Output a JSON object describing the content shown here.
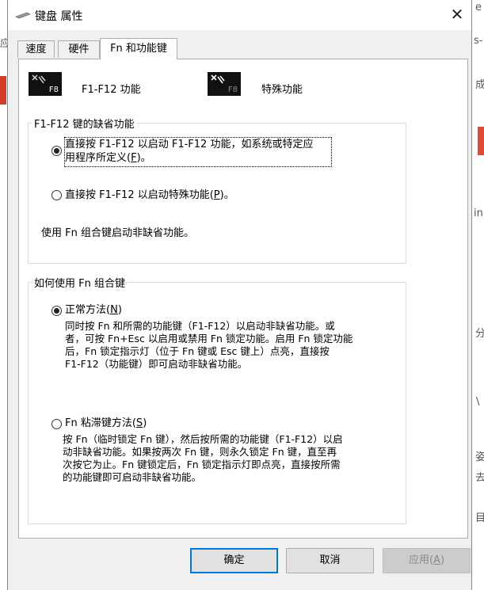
{
  "window": {
    "title": "键盘 属性",
    "close_symbol": "✕"
  },
  "tabs": [
    {
      "label": "速度"
    },
    {
      "label": "硬件"
    },
    {
      "label": "Fn 和功能键"
    }
  ],
  "fkeys": {
    "key_label": "F8",
    "fkey_mode_label": "F1-F12 功能",
    "special_mode_label": "特殊功能"
  },
  "group1": {
    "legend": "F1-F12 键的缺省功能",
    "option1_line1": "直接按 F1-F12 以启动 F1-F12 功能，如系统或特定应",
    "option1_line2_prefix": "用程序所定义(",
    "option1_mnemonic": "F",
    "option1_suffix": ")。",
    "option2_prefix": "直接按 F1-F12 以启动特殊功能(",
    "option2_mnemonic": "P",
    "option2_suffix": ")。",
    "note": "使用 Fn 组合键启动非缺省功能。"
  },
  "group2": {
    "legend": "如何使用 Fn 组合键",
    "normal_prefix": "正常方法(",
    "normal_mnemonic": "N",
    "normal_suffix": ")",
    "normal_desc": [
      "同时按 Fn 和所需的功能键（F1-F12）以启动非缺省功能。或",
      "者，可按 Fn+Esc 以启用或禁用 Fn 锁定功能。启用 Fn 锁定功能",
      "后，Fn 锁定指示灯（位于 Fn 键或 Esc 键上）点亮，直接按",
      "F1-F12（功能键）即可启动非缺省功能。"
    ],
    "sticky_prefix": "Fn 粘滞键方法(",
    "sticky_mnemonic": "S",
    "sticky_suffix": ")",
    "sticky_desc": [
      "按 Fn（临时锁定 Fn 键），然后按所需的功能键（F1-F12）以启",
      "动非缺省功能。如果按两次 Fn 键，则永久锁定 Fn 键，直至再",
      "次按它为止。Fn 键锁定后，Fn 锁定指示灯即点亮，直接按所需",
      "的功能键即可启动非缺省功能。"
    ]
  },
  "buttons": {
    "ok": "确定",
    "cancel": "取消",
    "apply_prefix": "应用(",
    "apply_mnemonic": "A",
    "apply_suffix": ")"
  },
  "background_chars": [
    "应",
    "e",
    "s-",
    "成",
    "in",
    "分",
    "\\",
    "姿",
    "去",
    "目"
  ],
  "colors": {
    "accent": "#0078d7",
    "panel": "#ffffff",
    "dialog": "#f0f0f0"
  }
}
